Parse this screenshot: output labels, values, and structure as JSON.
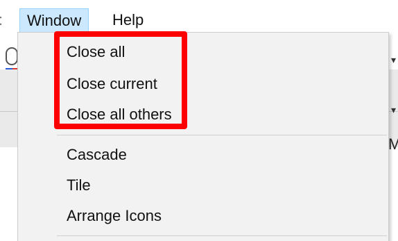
{
  "menubar": {
    "partial_left": ":",
    "items": [
      {
        "label": "Window",
        "active": true
      },
      {
        "label": "Help",
        "active": false
      }
    ]
  },
  "background": {
    "right_edge_text": "M"
  },
  "dropdown": {
    "groups": [
      [
        "Close all",
        "Close current",
        "Close all others"
      ],
      [
        "Cascade",
        "Tile",
        "Arrange Icons"
      ]
    ]
  },
  "annotation": {
    "highlight_color": "#ff0000"
  }
}
